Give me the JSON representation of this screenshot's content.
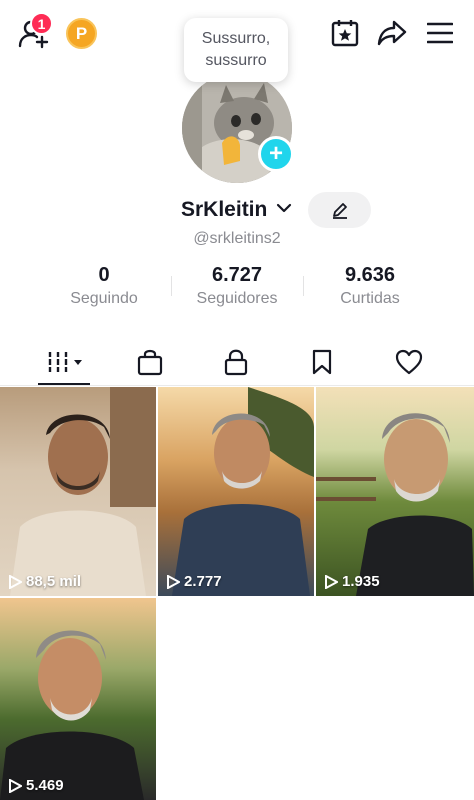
{
  "topbar": {
    "notification_count": "1",
    "coin_label": "P"
  },
  "profile": {
    "note_line1": "Sussurro,",
    "note_line2": "sussurro",
    "username": "SrKleitin",
    "handle": "@srkleitins2"
  },
  "stats": [
    {
      "value": "0",
      "label": "Seguindo"
    },
    {
      "value": "6.727",
      "label": "Seguidores"
    },
    {
      "value": "9.636",
      "label": "Curtidas"
    }
  ],
  "tabs": [
    "videos-grid-icon",
    "shopping-bag-icon",
    "lock-icon",
    "bookmark-icon",
    "heart-icon"
  ],
  "videos": [
    {
      "views": "88,5 mil"
    },
    {
      "views": "2.777"
    },
    {
      "views": "1.935"
    },
    {
      "views": "5.469"
    }
  ],
  "colors": {
    "accent_red": "#fe2c55",
    "accent_cyan": "#20d5ec",
    "coin": "#f5a623"
  }
}
